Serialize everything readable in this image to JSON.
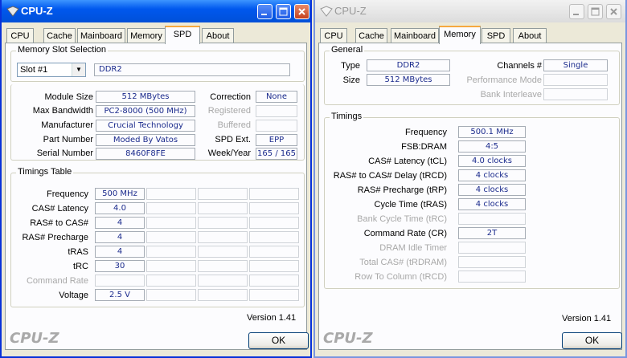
{
  "left_window": {
    "title": "CPU-Z",
    "tabs": [
      "CPU",
      "Cache",
      "Mainboard",
      "Memory",
      "SPD",
      "About"
    ],
    "selected_tab": "SPD",
    "slot_group": {
      "title": "Memory Slot Selection",
      "slot_value": "Slot #1",
      "type_value": "DDR2"
    },
    "module": {
      "module_size_label": "Module Size",
      "module_size": "512 MBytes",
      "max_bandwidth_label": "Max Bandwidth",
      "max_bandwidth": "PC2-8000 (500 MHz)",
      "manufacturer_label": "Manufacturer",
      "manufacturer": "Crucial Technology",
      "part_number_label": "Part Number",
      "part_number": "Moded By Vatos",
      "serial_number_label": "Serial Number",
      "serial_number": "8460F8FE",
      "correction_label": "Correction",
      "correction": "None",
      "registered_label": "Registered",
      "buffered_label": "Buffered",
      "spd_ext_label": "SPD Ext.",
      "spd_ext": "EPP",
      "week_year_label": "Week/Year",
      "week_year": "165 / 165"
    },
    "timings_table": {
      "title": "Timings Table",
      "rows": [
        {
          "label": "Frequency",
          "value": "500 MHz",
          "disabled": false
        },
        {
          "label": "CAS# Latency",
          "value": "4.0",
          "disabled": false
        },
        {
          "label": "RAS# to CAS#",
          "value": "4",
          "disabled": false
        },
        {
          "label": "RAS# Precharge",
          "value": "4",
          "disabled": false
        },
        {
          "label": "tRAS",
          "value": "4",
          "disabled": false
        },
        {
          "label": "tRC",
          "value": "30",
          "disabled": false
        },
        {
          "label": "Command Rate",
          "value": "",
          "disabled": true
        },
        {
          "label": "Voltage",
          "value": "2.5 V",
          "disabled": false
        }
      ]
    },
    "version": "Version 1.41",
    "logo": "CPU-Z",
    "ok_label": "OK"
  },
  "right_window": {
    "title": "CPU-Z",
    "tabs": [
      "CPU",
      "Cache",
      "Mainboard",
      "Memory",
      "SPD",
      "About"
    ],
    "selected_tab": "Memory",
    "general": {
      "title": "General",
      "type_label": "Type",
      "type": "DDR2",
      "size_label": "Size",
      "size": "512 MBytes",
      "channels_label": "Channels #",
      "channels": "Single",
      "performance_mode_label": "Performance Mode",
      "bank_interleave_label": "Bank Interleave"
    },
    "timings": {
      "title": "Timings",
      "rows": [
        {
          "label": "Frequency",
          "value": "500.1 MHz",
          "disabled": false
        },
        {
          "label": "FSB:DRAM",
          "value": "4:5",
          "disabled": false
        },
        {
          "label": "CAS# Latency (tCL)",
          "value": "4.0 clocks",
          "disabled": false
        },
        {
          "label": "RAS# to CAS# Delay (tRCD)",
          "value": "4 clocks",
          "disabled": false
        },
        {
          "label": "RAS# Precharge (tRP)",
          "value": "4 clocks",
          "disabled": false
        },
        {
          "label": "Cycle Time (tRAS)",
          "value": "4 clocks",
          "disabled": false
        },
        {
          "label": "Bank Cycle Time (tRC)",
          "value": "",
          "disabled": true
        },
        {
          "label": "Command Rate (CR)",
          "value": "2T",
          "disabled": false
        },
        {
          "label": "DRAM Idle Timer",
          "value": "",
          "disabled": true
        },
        {
          "label": "Total CAS# (tRDRAM)",
          "value": "",
          "disabled": true
        },
        {
          "label": "Row To Column (tRCD)",
          "value": "",
          "disabled": true
        }
      ]
    },
    "version": "Version 1.41",
    "logo": "CPU-Z",
    "ok_label": "OK"
  }
}
